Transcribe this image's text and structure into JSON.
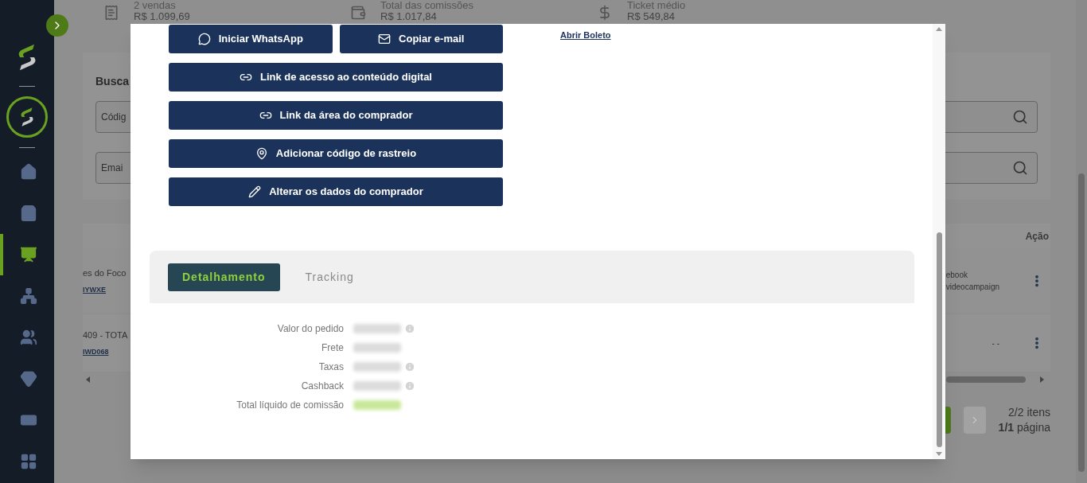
{
  "sidebar": {
    "items": [
      {
        "kind": "home",
        "selected": false
      },
      {
        "kind": "bag",
        "selected": false
      },
      {
        "kind": "chart",
        "selected": true
      },
      {
        "kind": "network",
        "selected": false
      },
      {
        "kind": "users",
        "selected": false
      },
      {
        "kind": "gem",
        "selected": false
      },
      {
        "kind": "money",
        "selected": false
      },
      {
        "kind": "grid",
        "selected": false
      }
    ]
  },
  "stats": [
    {
      "kind": "receipt",
      "label": "2 vendas",
      "value": "R$ 1.099,69"
    },
    {
      "kind": "wallet",
      "label": "Total das comissões",
      "value": "R$ 1.017,84"
    },
    {
      "kind": "dollar",
      "label": "Ticket médio",
      "value": "R$ 549,84"
    }
  ],
  "search": {
    "title": "Busca",
    "fields": [
      {
        "placeholder": "Códig"
      },
      {
        "placeholder": "Emai"
      }
    ]
  },
  "table": {
    "action_column": "Ação",
    "rows": [
      {
        "product": "es do Foco",
        "code": "IYWXE",
        "source": [
          "ebook",
          "videocampaign"
        ]
      },
      {
        "product": "409 - TOTA",
        "code": "IWD068",
        "source": [
          "- -"
        ]
      }
    ]
  },
  "pagination": {
    "items": "2/2 itens",
    "pages": "**1/1** página"
  },
  "modal": {
    "actions": [
      {
        "label": "Iniciar WhatsApp",
        "kind": "whatsapp"
      },
      {
        "label": "Copiar e-mail",
        "kind": "mail"
      },
      {
        "label": "Link de acesso ao conteúdo digital",
        "kind": "link"
      },
      {
        "label": "Link da área do comprador",
        "kind": "link"
      },
      {
        "label": "Adicionar código de rastreio",
        "kind": "pin"
      },
      {
        "label": "Alterar os dados do comprador",
        "kind": "pencil"
      }
    ],
    "boleto_link": "Abrir Boleto",
    "tabs": [
      {
        "label": "Detalhamento",
        "selected": true
      },
      {
        "label": "Tracking",
        "selected": false
      }
    ],
    "details": [
      {
        "label": "Valor do pedido",
        "info": true,
        "kind": "plain"
      },
      {
        "label": "Frete",
        "info": false,
        "kind": "plain"
      },
      {
        "label": "Taxas",
        "info": true,
        "kind": "plain"
      },
      {
        "label": "Cashback",
        "info": true,
        "kind": "plain"
      },
      {
        "label": "Total líquido de comissão",
        "info": false,
        "kind": "total"
      }
    ]
  }
}
